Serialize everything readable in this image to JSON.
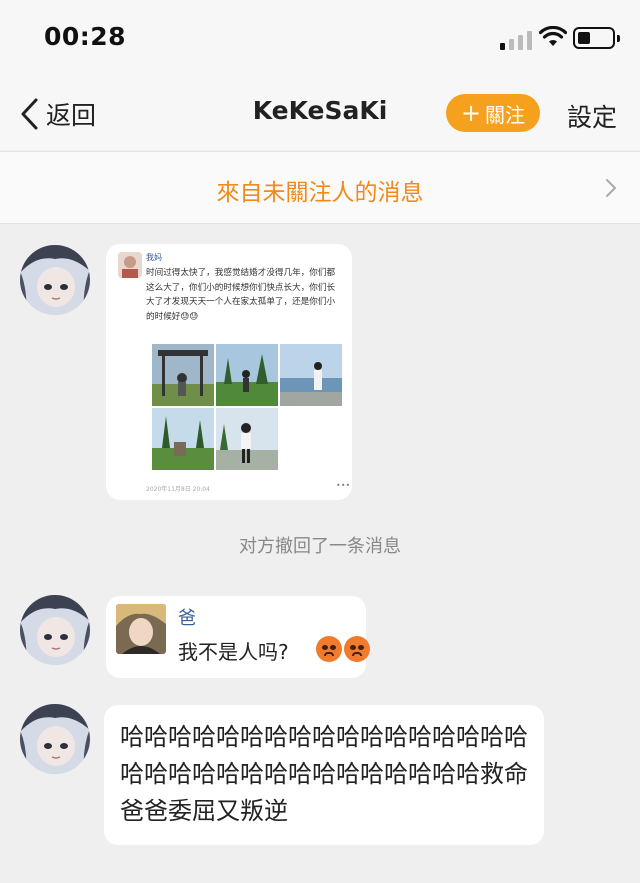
{
  "status_bar": {
    "time": "00:28",
    "signal_bars_active": 1,
    "signal_bars_total": 4,
    "battery_level": 0.35
  },
  "nav": {
    "back_label": "返回",
    "title": "KeKeSaKi",
    "follow_label": "關注",
    "follow_icon": "+",
    "settings_label": "設定",
    "accent_color": "#f6a11d"
  },
  "banner": {
    "text": "來自未關注人的消息",
    "color": "#f18a1a",
    "icon": "chevron-right-icon"
  },
  "messages": [
    {
      "type": "image",
      "screenshot": {
        "sender": "我妈",
        "text": "时间过得太快了，我感觉结婚才没得几年，你们都这么大了，你们小的时候想你们快点长大，你们长大了才发现天天一个人在家太孤单了，还是你们小的时候好😓😓",
        "timestamp": "2020年11月8日 20:04",
        "more_icon": "•••",
        "photo_count": 5
      }
    },
    {
      "type": "system",
      "text": "对方撤回了一条消息"
    },
    {
      "type": "quote",
      "name": "爸",
      "text": "我不是人吗?",
      "emojis": [
        "pouting-face-emoji",
        "pouting-face-emoji"
      ]
    },
    {
      "type": "text",
      "text": "哈哈哈哈哈哈哈哈哈哈哈哈哈哈哈哈哈哈哈哈哈哈哈哈哈哈哈哈哈哈哈哈救命 爸爸委屈又叛逆"
    }
  ]
}
